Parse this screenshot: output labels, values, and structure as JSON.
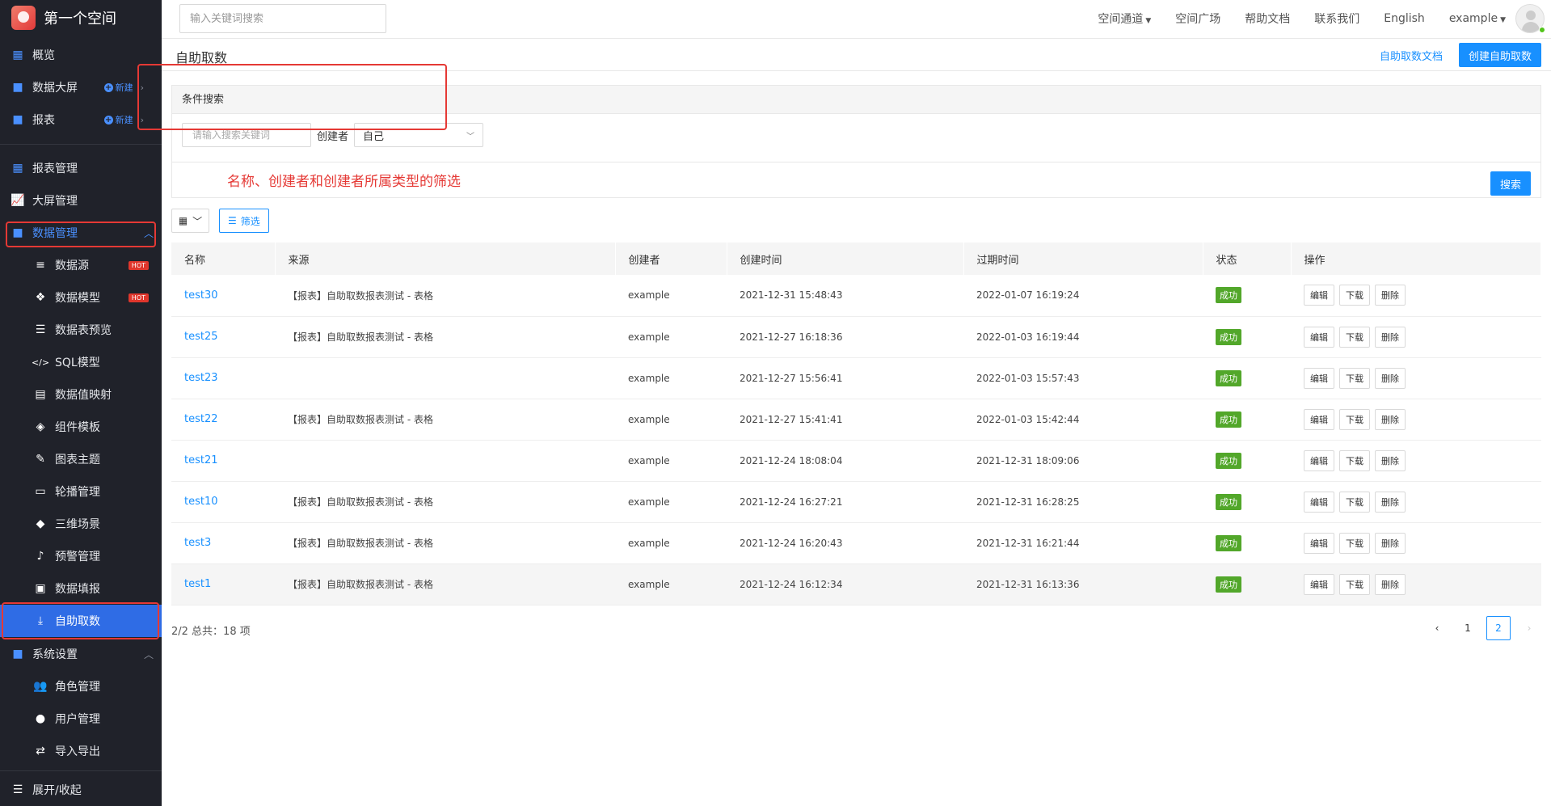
{
  "app": {
    "space_name": "第一个空间"
  },
  "sidebar": {
    "new_label": "新建",
    "hot_label": "HOT",
    "items": [
      {
        "label": "概览",
        "icon": "dashboard-grid-icon"
      },
      {
        "label": "数据大屏",
        "icon": "folder-icon"
      },
      {
        "label": "报表",
        "icon": "folder-icon"
      },
      {
        "label": "报表管理",
        "icon": "table-grid-icon"
      },
      {
        "label": "大屏管理",
        "icon": "chart-line-icon"
      },
      {
        "label": "数据管理",
        "icon": "folder-icon"
      },
      {
        "label": "数据源",
        "icon": "database-icon"
      },
      {
        "label": "数据模型",
        "icon": "cubes-icon"
      },
      {
        "label": "数据表预览",
        "icon": "list-icon"
      },
      {
        "label": "SQL模型",
        "icon": "code-icon"
      },
      {
        "label": "数据值映射",
        "icon": "book-icon"
      },
      {
        "label": "组件模板",
        "icon": "layers-icon"
      },
      {
        "label": "图表主题",
        "icon": "magic-wand-icon"
      },
      {
        "label": "轮播管理",
        "icon": "monitor-icon"
      },
      {
        "label": "三维场景",
        "icon": "cube-icon"
      },
      {
        "label": "预警管理",
        "icon": "bell-icon"
      },
      {
        "label": "数据填报",
        "icon": "form-icon"
      },
      {
        "label": "自助取数",
        "icon": "download-icon"
      },
      {
        "label": "系统设置",
        "icon": "folder-icon"
      },
      {
        "label": "角色管理",
        "icon": "users-icon"
      },
      {
        "label": "用户管理",
        "icon": "user-icon"
      },
      {
        "label": "导入导出",
        "icon": "exchange-icon"
      }
    ],
    "collapse_label": "展开/收起"
  },
  "topbar": {
    "search_placeholder": "输入关键词搜索",
    "links": [
      "空间通道",
      "空间广场",
      "帮助文档",
      "联系我们",
      "English",
      "example"
    ]
  },
  "page": {
    "title": "自助取数",
    "doc_link": "自助取数文档",
    "create_button": "创建自助取数"
  },
  "filter": {
    "header": "条件搜索",
    "keyword_placeholder": "请输入搜索关键词",
    "creator_label": "创建者",
    "creator_value": "自己",
    "annotation": "名称、创建者和创建者所属类型的筛选",
    "search_button": "搜索",
    "filter_button": "筛选"
  },
  "table": {
    "columns": [
      "名称",
      "来源",
      "创建者",
      "创建时间",
      "过期时间",
      "状态",
      "操作"
    ],
    "actions": [
      "编辑",
      "下载",
      "删除"
    ],
    "rows": [
      {
        "name": "test30",
        "source": "【报表】自助取数报表测试 - 表格",
        "creator": "example",
        "created": "2021-12-31 15:48:43",
        "expires": "2022-01-07 16:19:24",
        "status": "成功"
      },
      {
        "name": "test25",
        "source": "【报表】自助取数报表测试 - 表格",
        "creator": "example",
        "created": "2021-12-27 16:18:36",
        "expires": "2022-01-03 16:19:44",
        "status": "成功"
      },
      {
        "name": "test23",
        "source": "",
        "creator": "example",
        "created": "2021-12-27 15:56:41",
        "expires": "2022-01-03 15:57:43",
        "status": "成功"
      },
      {
        "name": "test22",
        "source": "【报表】自助取数报表测试 - 表格",
        "creator": "example",
        "created": "2021-12-27 15:41:41",
        "expires": "2022-01-03 15:42:44",
        "status": "成功"
      },
      {
        "name": "test21",
        "source": "",
        "creator": "example",
        "created": "2021-12-24 18:08:04",
        "expires": "2021-12-31 18:09:06",
        "status": "成功"
      },
      {
        "name": "test10",
        "source": "【报表】自助取数报表测试 - 表格",
        "creator": "example",
        "created": "2021-12-24 16:27:21",
        "expires": "2021-12-31 16:28:25",
        "status": "成功"
      },
      {
        "name": "test3",
        "source": "【报表】自助取数报表测试 - 表格",
        "creator": "example",
        "created": "2021-12-24 16:20:43",
        "expires": "2021-12-31 16:21:44",
        "status": "成功"
      },
      {
        "name": "test1",
        "source": "【报表】自助取数报表测试 - 表格",
        "creator": "example",
        "created": "2021-12-24 16:12:34",
        "expires": "2021-12-31 16:13:36",
        "status": "成功"
      }
    ]
  },
  "pagination": {
    "summary": "2/2 总共：18 项",
    "pages": [
      "1",
      "2"
    ],
    "current": "2"
  },
  "colors": {
    "accent": "#1890ff",
    "sidebar_bg": "#20222a",
    "active_bg": "#2f6ce5",
    "success": "#52a72a",
    "annotation": "#e53935"
  }
}
